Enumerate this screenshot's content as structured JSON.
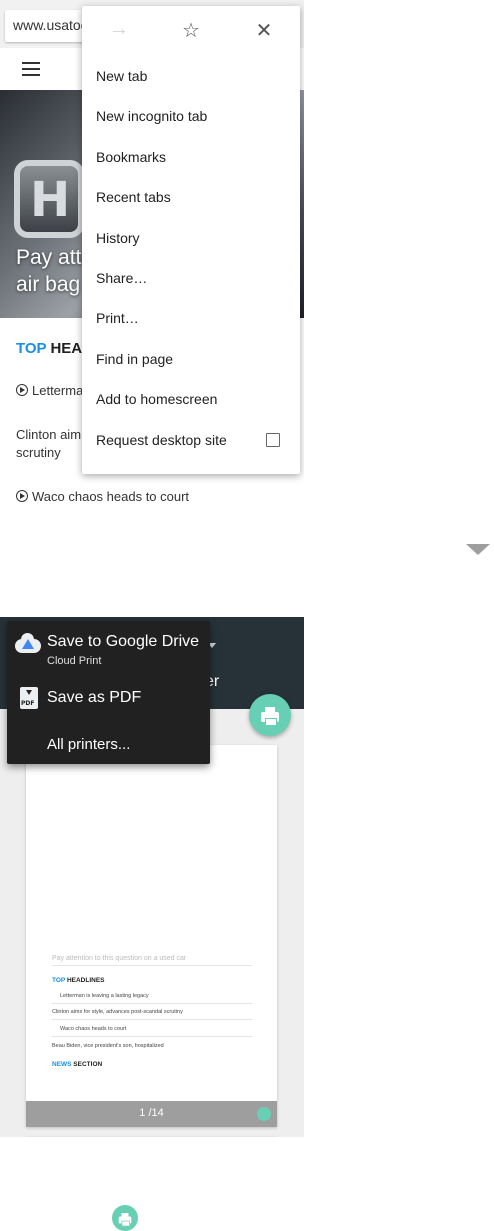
{
  "browser": {
    "url": "www.usatoday.com",
    "hero_lines": [
      "Pay atte",
      "air bag"
    ],
    "section_head": {
      "blue": "TOP",
      "rest": " HEA"
    },
    "headlines": [
      "Letterma",
      "Clinton aim",
      "scrutiny",
      "Waco chaos heads to court"
    ]
  },
  "overflow_menu": {
    "icons": [
      "forward-icon",
      "star-icon",
      "close-icon"
    ],
    "items": [
      "New tab",
      "New incognito tab",
      "Bookmarks",
      "Recent tabs",
      "History",
      "Share…",
      "Print…",
      "Find in page",
      "Add to homescreen",
      "Request desktop site"
    ],
    "request_desktop_checked": false
  },
  "print": {
    "header_peek": "er",
    "destinations": {
      "drive_title": "Save to Google Drive",
      "drive_sub": "Cloud Print",
      "pdf_title": "Save as PDF",
      "all_printers": "All printers..."
    },
    "preview": {
      "faint_line": "Pay attention to this question on a used car",
      "top_head": {
        "blue": "TOP",
        "rest": " HEADLINES"
      },
      "lines": [
        "Letterman is leaving a lasting legacy",
        "Clinton aims for style, advances post-scandal scrutiny",
        "Waco chaos heads to court",
        "Beau Biden, vice president's son, hospitalized"
      ],
      "news_head": {
        "blue": "NEWS",
        "rest": " SECTION"
      },
      "page_indicator": "1 /14"
    }
  },
  "colors": {
    "accent": "#67cfb3",
    "header": "#263238",
    "link_blue": "#1a8fe3"
  }
}
